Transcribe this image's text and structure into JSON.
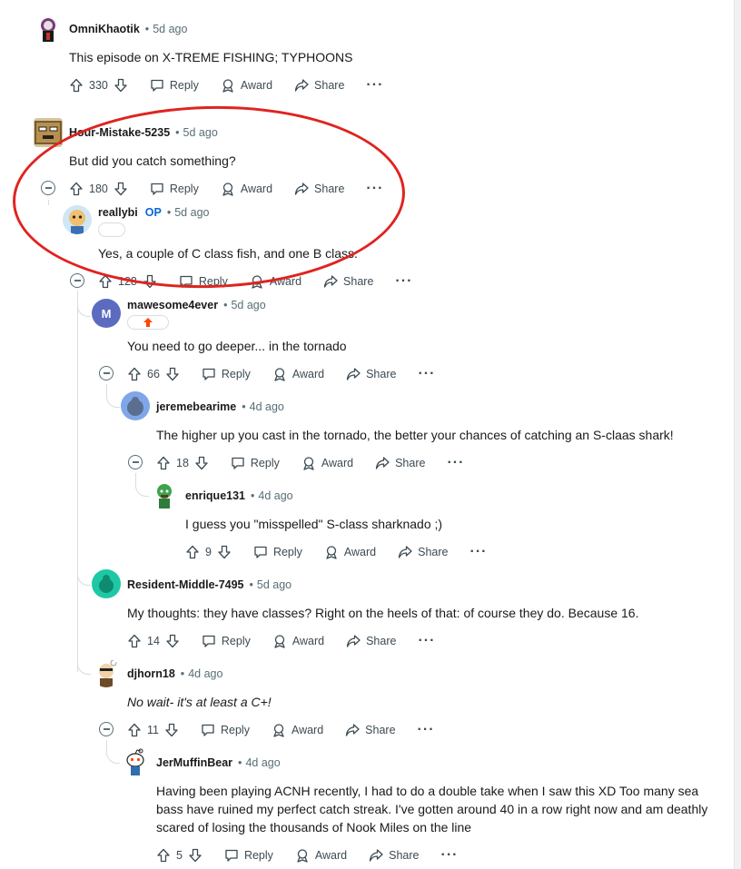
{
  "comments": [
    {
      "author": "OmniKhaotik",
      "op": "",
      "time": "5d ago",
      "body": "This episode on X-TREME FISHING; TYPHOONS",
      "score": "330"
    },
    {
      "author": "Hour-Mistake-5235",
      "op": "",
      "time": "5d ago",
      "body": "But did you catch something?",
      "score": "180"
    },
    {
      "author": "reallybi",
      "op": "OP",
      "time": "5d ago",
      "body": "Yes, a couple of C class fish, and one B class.",
      "score": "128"
    },
    {
      "author": "mawesome4ever",
      "op": "",
      "time": "5d ago",
      "body": "You need to go deeper... in the tornado",
      "score": "66"
    },
    {
      "author": "jeremebearime",
      "op": "",
      "time": "4d ago",
      "body": "The higher up you cast in the tornado, the better your chances of catching an S-claas shark!",
      "score": "18"
    },
    {
      "author": "enrique131",
      "op": "",
      "time": "4d ago",
      "body": "I guess you \"misspelled\" S-class sharknado ;)",
      "score": "9"
    },
    {
      "author": "Resident-Middle-7495",
      "op": "",
      "time": "5d ago",
      "body": "My thoughts: they have classes? Right on the heels of that: of course they do.  Because 16.",
      "score": "14"
    },
    {
      "author": "djhorn18",
      "op": "",
      "time": "4d ago",
      "body": "No wait- it's at least a C+!",
      "score": "11"
    },
    {
      "author": "JerMuffinBear",
      "op": "",
      "time": "4d ago",
      "body": "Having been playing ACNH recently, I had to do a double take when I saw this XD Too many sea bass have ruined my perfect catch streak. I've gotten around 40 in a row right now and am deathly scared of losing the thousands of Nook Miles on the line",
      "score": "5"
    }
  ],
  "actions": {
    "reply": "Reply",
    "award": "Award",
    "share": "Share",
    "more": "···"
  },
  "avatar_letters": {
    "mawesome4ever": "M"
  },
  "dot": "•",
  "colors": {
    "accent_op": "#0a66d8",
    "annotation": "#e0231f",
    "thread": "#d8dde0",
    "avatar_m": "#5c6bc0",
    "avatar_teal": "#1fc8a5"
  }
}
